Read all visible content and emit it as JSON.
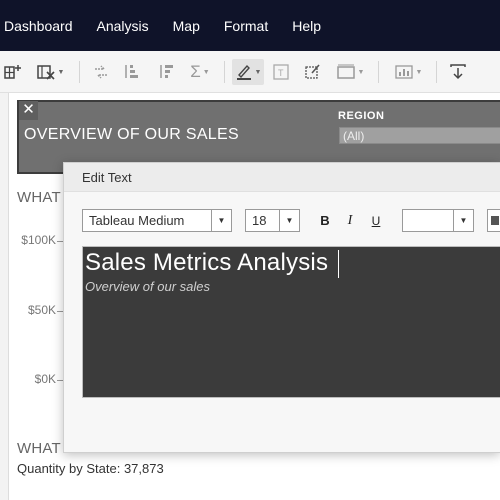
{
  "menu": [
    "Dashboard",
    "Analysis",
    "Map",
    "Format",
    "Help"
  ],
  "toolbar": {
    "icons": [
      "new-datasource-icon",
      "clear-sheet-icon",
      "swap-icon",
      "sort-ascending-icon",
      "sort-descending-icon",
      "totals-icon",
      "highlight-icon",
      "text-label-icon",
      "annotate-icon",
      "fit-width-icon",
      "show-me-icon",
      "download-icon"
    ]
  },
  "dashboard": {
    "header_title": "OVERVIEW OF OUR SALES",
    "close_glyph": "✕",
    "region_label": "REGION",
    "region_value": "(All)",
    "sheet1_title": "WHAT",
    "sheet2_title": "WHAT",
    "axis_labels": [
      "$100K",
      "$50K",
      "$0K"
    ],
    "quantity_label": "Quantity by State: 37,873"
  },
  "dialog": {
    "title": "Edit Text",
    "font_family": "Tableau Medium",
    "font_size": "18",
    "bold": "B",
    "italic": "I",
    "underline": "U",
    "color_value": "",
    "dropdown_glyph": "▼",
    "text_title": "Sales Metrics Analysis",
    "text_subtitle": "Overview of our sales"
  },
  "colors": {
    "menubar": "#0f1329",
    "header_band": "#707070",
    "editor_bg": "#3b3b3b"
  }
}
